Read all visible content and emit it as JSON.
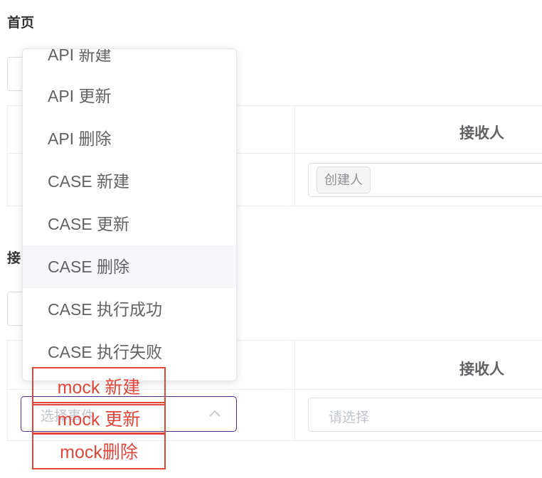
{
  "section1": {
    "title": "首页"
  },
  "section2": {
    "title_partial": "接"
  },
  "table1": {
    "header_receiver": "接收人",
    "row_tag": "创建人"
  },
  "table2": {
    "header_receiver": "接收人",
    "event_select_placeholder": "选择事件",
    "receiver_placeholder": "请选择"
  },
  "dropdown": {
    "items": [
      "API 新建",
      "API 更新",
      "API 删除",
      "CASE 新建",
      "CASE 更新",
      "CASE 删除",
      "CASE 执行成功",
      "CASE 执行失败"
    ],
    "hovered_item": "CASE 删除"
  },
  "annotations": [
    "mock 新建",
    "mock 更新",
    "mock删除"
  ],
  "colors": {
    "annotation": "#e0463a",
    "select_border_active": "#5b2d8a",
    "hover_bg": "#f5f7fa"
  }
}
